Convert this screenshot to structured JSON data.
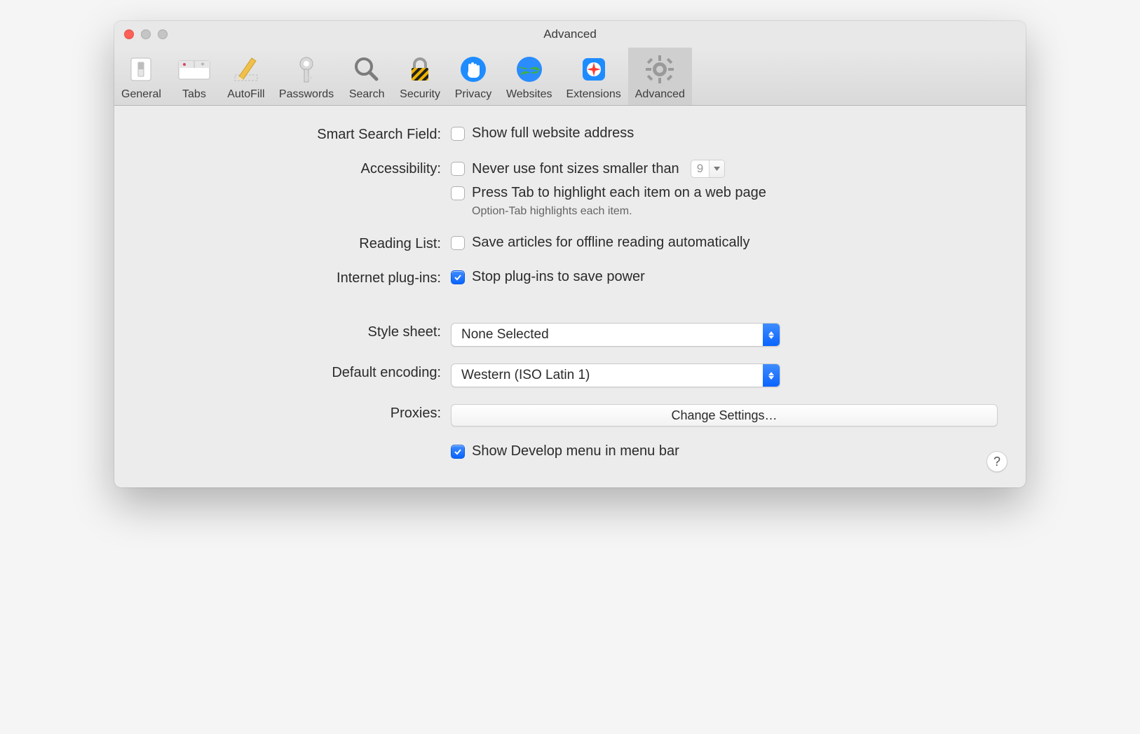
{
  "window": {
    "title": "Advanced"
  },
  "toolbar": {
    "items": [
      {
        "id": "general",
        "label": "General"
      },
      {
        "id": "tabs",
        "label": "Tabs"
      },
      {
        "id": "autofill",
        "label": "AutoFill"
      },
      {
        "id": "passwords",
        "label": "Passwords"
      },
      {
        "id": "search",
        "label": "Search"
      },
      {
        "id": "security",
        "label": "Security"
      },
      {
        "id": "privacy",
        "label": "Privacy"
      },
      {
        "id": "websites",
        "label": "Websites"
      },
      {
        "id": "extensions",
        "label": "Extensions"
      },
      {
        "id": "advanced",
        "label": "Advanced",
        "selected": true
      }
    ]
  },
  "sections": {
    "smart_search": {
      "label": "Smart Search Field:",
      "show_full_address": {
        "label": "Show full website address",
        "checked": false
      }
    },
    "accessibility": {
      "label": "Accessibility:",
      "min_font": {
        "label": "Never use font sizes smaller than",
        "checked": false,
        "value": "9"
      },
      "press_tab": {
        "label": "Press Tab to highlight each item on a web page",
        "checked": false,
        "help": "Option-Tab highlights each item."
      }
    },
    "reading_list": {
      "label": "Reading List:",
      "save_offline": {
        "label": "Save articles for offline reading automatically",
        "checked": false
      }
    },
    "plugins": {
      "label": "Internet plug-ins:",
      "stop_plugins": {
        "label": "Stop plug-ins to save power",
        "checked": true
      }
    },
    "style_sheet": {
      "label": "Style sheet:",
      "value": "None Selected"
    },
    "encoding": {
      "label": "Default encoding:",
      "value": "Western (ISO Latin 1)"
    },
    "proxies": {
      "label": "Proxies:",
      "button": "Change Settings…"
    },
    "develop": {
      "show_develop": {
        "label": "Show Develop menu in menu bar",
        "checked": true
      }
    }
  },
  "help_button": "?"
}
